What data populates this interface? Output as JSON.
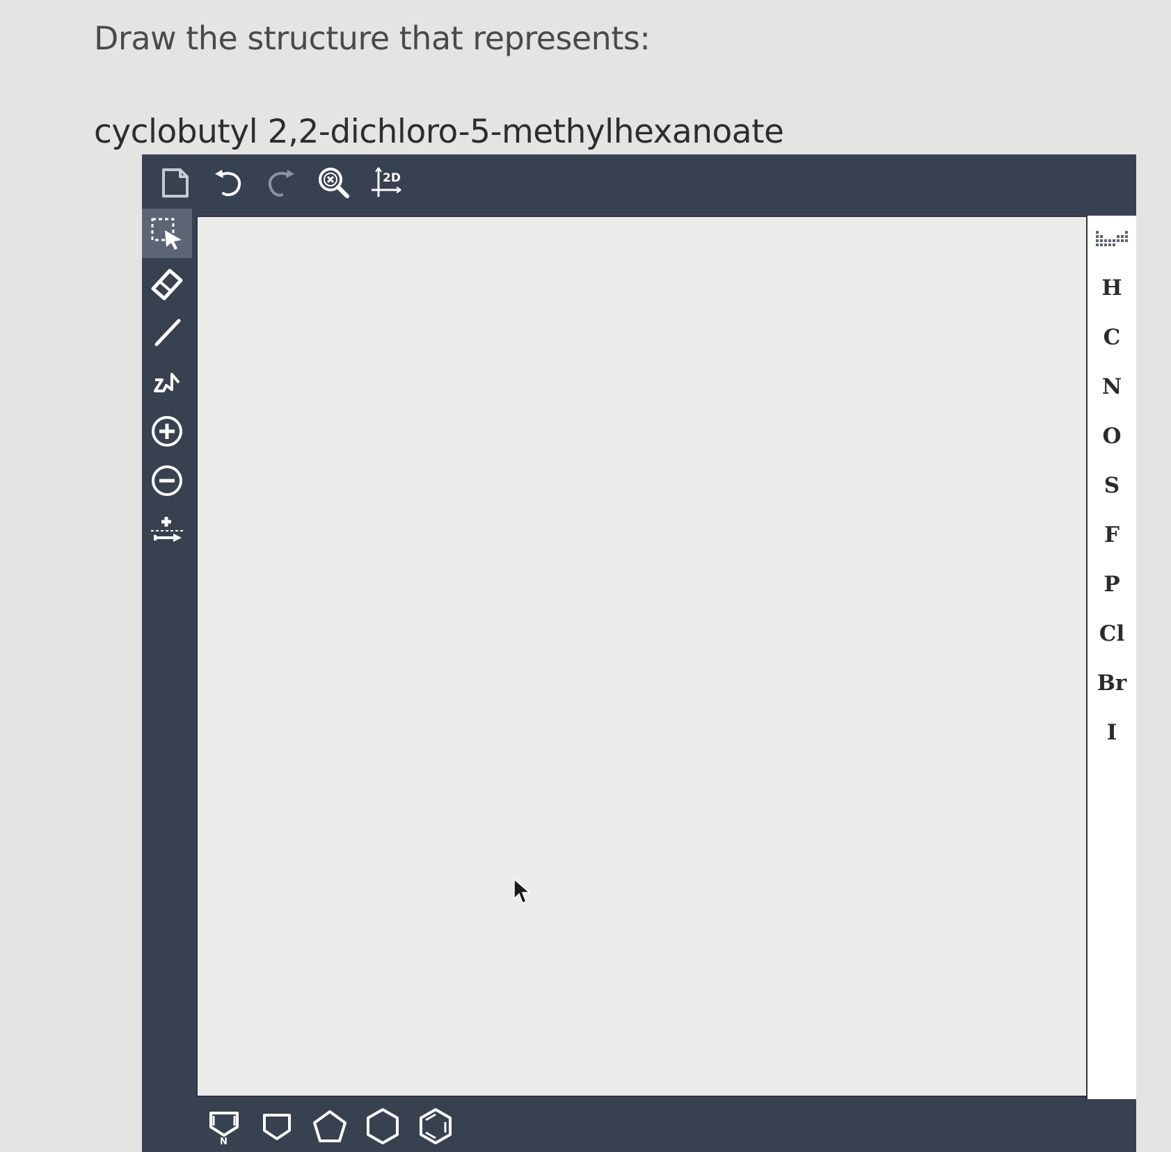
{
  "question": {
    "instruction": "Draw the structure that represents:",
    "compound_name": "cyclobutyl 2,2-dichloro-5-methylhexanoate"
  },
  "top_toolbar": [
    {
      "name": "clear-canvas",
      "icon": "document-icon"
    },
    {
      "name": "undo",
      "icon": "undo-icon"
    },
    {
      "name": "redo",
      "icon": "redo-icon"
    },
    {
      "name": "zoom-clear",
      "icon": "magnifier-x-icon"
    },
    {
      "name": "clean-2d",
      "icon": "clean-2d-icon",
      "label": "2D"
    }
  ],
  "left_toolbar": [
    {
      "name": "select",
      "icon": "selection-arrow-icon",
      "active": true
    },
    {
      "name": "erase",
      "icon": "eraser-icon"
    },
    {
      "name": "single-bond",
      "icon": "bond-line-icon"
    },
    {
      "name": "chain",
      "icon": "chain-icon"
    },
    {
      "name": "positive-charge",
      "icon": "plus-circle-icon"
    },
    {
      "name": "negative-charge",
      "icon": "minus-circle-icon"
    },
    {
      "name": "reaction-arrow",
      "icon": "reaction-arrow-icon"
    }
  ],
  "elements": [
    "H",
    "C",
    "N",
    "O",
    "S",
    "F",
    "P",
    "Cl",
    "Br",
    "I"
  ],
  "periodic_table_icon": "periodic-table-icon",
  "bottom_templates": [
    {
      "name": "pyrrole-template",
      "icon": "n-ring-icon",
      "label": "N"
    },
    {
      "name": "cyclobutane-template",
      "icon": "square-ring-icon"
    },
    {
      "name": "cyclopentane-template",
      "icon": "pentagon-icon"
    },
    {
      "name": "cyclohexane-template",
      "icon": "hexagon-icon"
    },
    {
      "name": "benzene-template",
      "icon": "benzene-icon"
    }
  ],
  "colors": {
    "toolbar_bg": "#384150",
    "canvas_bg": "#ebecea",
    "panel_bg": "#ffffff",
    "icon": "#ffffff",
    "active_tool": "#5c6573"
  }
}
